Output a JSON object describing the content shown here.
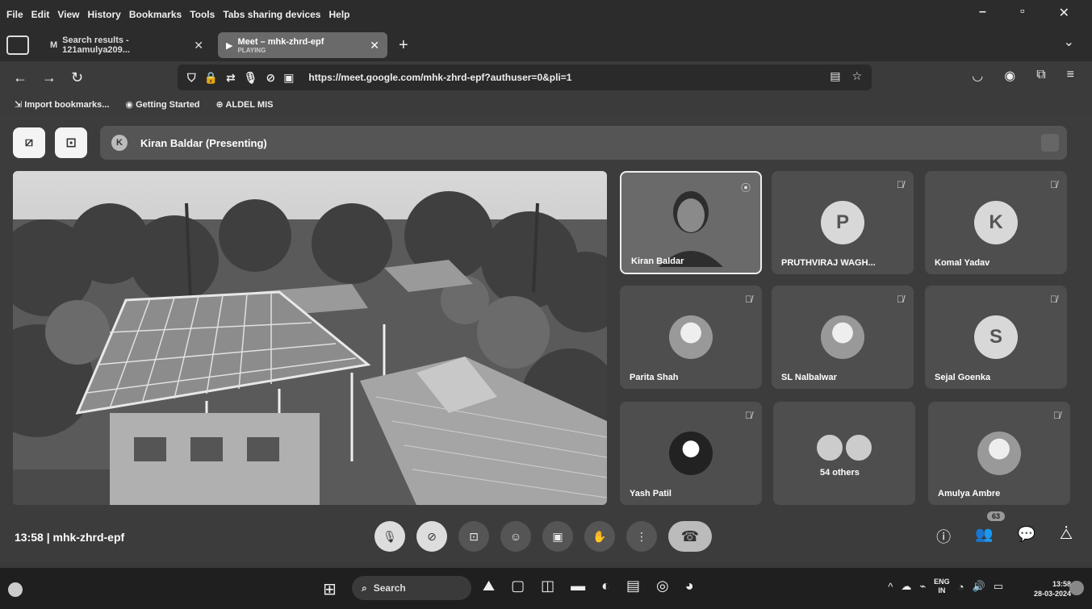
{
  "menu": [
    "File",
    "Edit",
    "View",
    "History",
    "Bookmarks",
    "Tools",
    "Tabs sharing devices",
    "Help"
  ],
  "tabs": [
    {
      "title": "Search results - 121amulya209...",
      "icon": "gmail-icon"
    },
    {
      "title": "Meet – mhk-zhrd-epf",
      "subtitle": "PLAYING",
      "icon": "meet-icon"
    }
  ],
  "url": "https://meet.google.com/mhk-zhrd-epf?authuser=0&pli=1",
  "bookmarks": [
    "Import bookmarks...",
    "Getting Started",
    "ALDEL MIS"
  ],
  "presenter": {
    "initial": "K",
    "label": "Kiran Baldar (Presenting)"
  },
  "participants": [
    {
      "name": "Kiran Baldar",
      "avatar": "",
      "type": "video",
      "muted": false
    },
    {
      "name": "PRUTHVIRAJ WAGH...",
      "avatar": "P",
      "type": "letter",
      "muted": true
    },
    {
      "name": "Komal Yadav",
      "avatar": "K",
      "type": "letter",
      "muted": true
    },
    {
      "name": "Parita Shah",
      "avatar": "",
      "type": "photo",
      "muted": true
    },
    {
      "name": "SL Nalbalwar",
      "avatar": "",
      "type": "photo",
      "muted": true
    },
    {
      "name": "Sejal Goenka",
      "avatar": "S",
      "type": "letter",
      "muted": true
    },
    {
      "name": "Yash Patil",
      "avatar": "",
      "type": "dark",
      "muted": true
    },
    {
      "name": "54 others",
      "avatar": "",
      "type": "group",
      "muted": false
    },
    {
      "name": "Amulya Ambre",
      "avatar": "",
      "type": "photo",
      "muted": true
    }
  ],
  "meeting": {
    "time": "13:58",
    "separator": "|",
    "code": "mhk-zhrd-epf"
  },
  "people_badge": "63",
  "taskbar": {
    "search": "Search",
    "lang1": "ENG",
    "lang2": "IN",
    "time": "13:58",
    "date": "28-03-2024"
  }
}
